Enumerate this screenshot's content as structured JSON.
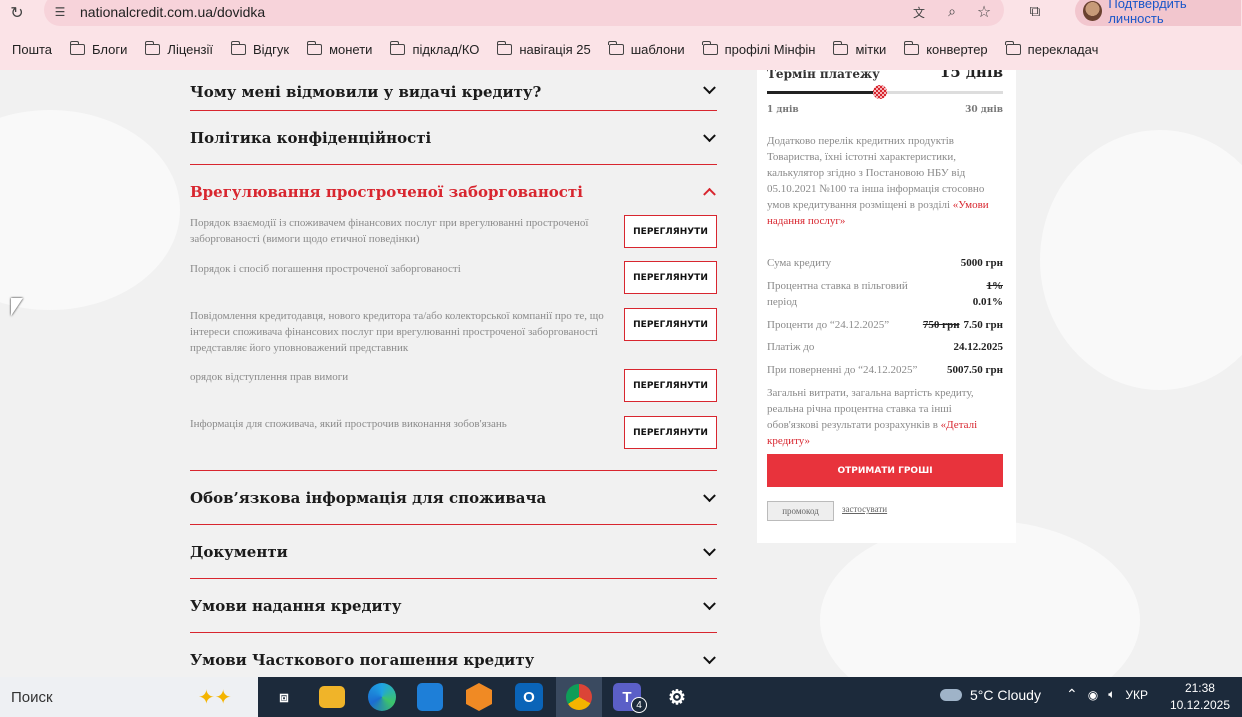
{
  "browser": {
    "url": "nationalcredit.com.ua/dovidka",
    "profile_label": "Подтвердить личность",
    "bookmarks": [
      "Пошта",
      "Блоги",
      "Ліцензії",
      "Відгук",
      "монети",
      "підклад/КО",
      "навігація 25",
      "шаблони",
      "профілі Мінфін",
      "мітки",
      "конвертер",
      "перекладач"
    ]
  },
  "accordion": {
    "top_items": [
      "Чому мені відмовили у видачі кредиту?",
      "Політика конфіденційності"
    ],
    "active_title": "Врегулювання простроченої заборгованості",
    "sub_items": [
      {
        "text": "Порядок взаємодії із споживачем фінансових послуг при врегулюванні простроченої заборгованості (вимоги щодо етичної поведінки)",
        "button": "ПЕРЕГЛЯНУТИ"
      },
      {
        "text": "Порядок і спосіб погашення простроченої заборгованості",
        "button": "ПЕРЕГЛЯНУТИ"
      },
      {
        "text": "Повідомлення кредитодавця, нового кредитора та/або колекторської компанії про те, що інтереси споживача фінансових послуг при врегулюванні простроченої заборгованості представляє його уповноважений представник",
        "button": "ПЕРЕГЛЯНУТИ"
      },
      {
        "text": "орядок відступлення прав вимоги",
        "button": "ПЕРЕГЛЯНУТИ"
      },
      {
        "text": "Інформація для споживача, який прострочив виконання зобов'язань",
        "button": "ПЕРЕГЛЯНУТИ"
      }
    ],
    "bottom_items": [
      "Обов’язкова інформація для споживача",
      "Документи",
      "Умови надання кредиту",
      "Умови Часткового погашення кредиту"
    ]
  },
  "calculator": {
    "term_label": "Термін платежу",
    "term_value": "15 днів",
    "slider_min": "1 днів",
    "slider_max": "30 днів",
    "slider_fraction": 0.48,
    "description": "Додатково перелік кредитних продуктів Товариства, їхні істотні характеристики, калькулятор згідно з Постановою НБУ від 05.10.2021 №100 та інша інформація стосовно умов кредитування розміщені в розділі",
    "description_link": "«Умови надання послуг»",
    "rows": {
      "amount_label": "Сума кредиту",
      "amount_value": "5000 грн",
      "rate_label": "Процентна ставка в пільговий період",
      "rate_old": "1%",
      "rate_new": "0.01%",
      "interest_label": "Проценти до “24.12.2025”",
      "interest_old": "750 грн",
      "interest_new": "7.50 грн",
      "payment_label": "Платіж до",
      "payment_value": "24.12.2025",
      "return_label": "При поверненні до “24.12.2025”",
      "return_value": "5007.50 грн"
    },
    "costs_text": "Загальні витрати, загальна вартість кредиту, реальна річна процентна ставка та інші обов'язкові результати розрахунків в",
    "costs_link": "«Деталі кредиту»",
    "cta": "ОТРИМАТИ ГРОШІ",
    "promo_placeholder": "промокод",
    "apply_label": "застосувати"
  },
  "taskbar": {
    "search": "Поиск",
    "teams_badge": "4",
    "weather": "5°C  Cloudy",
    "lang": "УКР",
    "time": "21:38",
    "date": "10.12.2025"
  },
  "colors": {
    "accent": "#d8262f",
    "cta": "#e8333c",
    "chrome": "#fbe3e7",
    "taskbar": "#1c2a3b"
  }
}
